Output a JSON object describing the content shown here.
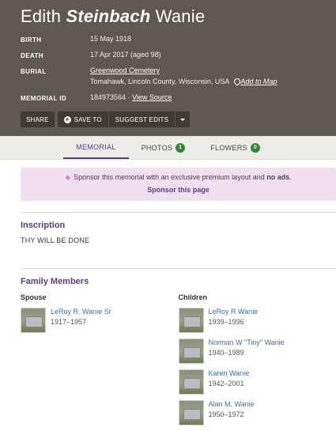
{
  "header": {
    "first_name": "Edith",
    "middle_name": "Steinbach",
    "last_name": "Wanie",
    "facts": {
      "birth_label": "BIRTH",
      "birth_value": "15 May 1918",
      "death_label": "DEATH",
      "death_value": "17 Apr 2017 (aged 98)",
      "burial_label": "BURIAL",
      "burial_cemetery": "Greenwood Cemetery",
      "burial_location": "Tomahawk, Lincoln County, Wisconsin, USA",
      "add_to_map": "Add to Map",
      "memorial_id_label": "MEMORIAL ID",
      "memorial_id_value": "184973564",
      "view_source": "View Source"
    },
    "actions": {
      "share": "SHARE",
      "save_to": "SAVE TO",
      "suggest_edits": "SUGGEST EDITS"
    }
  },
  "tabs": [
    {
      "label": "MEMORIAL",
      "active": true
    },
    {
      "label": "PHOTOS",
      "count": "1"
    },
    {
      "label": "FLOWERS",
      "count": "0"
    }
  ],
  "sponsor": {
    "text": "Sponsor this memorial with an exclusive premium layout",
    "and": "and",
    "no_ads": "no ads",
    "link": "Sponsor this page"
  },
  "inscription": {
    "title": "Inscription",
    "text": "THY WILL BE DONE"
  },
  "family": {
    "title": "Family Members",
    "spouse_label": "Spouse",
    "children_label": "Children",
    "spouse": [
      {
        "name": "LeRoy R. Wanie Sr",
        "dates": "1917–1957"
      }
    ],
    "children": [
      {
        "name": "LeRoy R Wanie",
        "dates": "1939–1996"
      },
      {
        "name": "Norman W \"Tiny\" Wanie",
        "dates": "1940–1989"
      },
      {
        "name": "Karen Wanie",
        "dates": "1942–2001"
      },
      {
        "name": "Alan M. Wanie",
        "dates": "1950–1972"
      }
    ]
  },
  "colors": {
    "header_bg": "#5e5850",
    "accent_purple": "#5a3d8a",
    "badge_green": "#2f8a2f",
    "link_blue": "#3a6fa5",
    "sponsor_bg": "#f2dff0"
  }
}
